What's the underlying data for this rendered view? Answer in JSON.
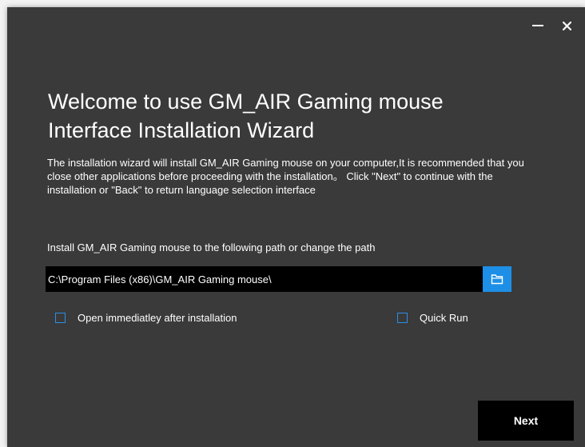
{
  "window": {
    "minimize_label": "—",
    "close_label": "✕"
  },
  "heading": {
    "line1": "Welcome to use GM_AIR Gaming mouse",
    "line2": "Interface Installation Wizard"
  },
  "description": "The installation wizard will install GM_AIR Gaming mouse on your computer,It is recommended that you close other applications before proceeding with the installation。 Click \"Next\" to continue with the installation or \"Back\" to return language selection interface",
  "install_path": {
    "label": "Install GM_AIR Gaming mouse to the following path or change the path",
    "value": "C:\\Program Files (x86)\\GM_AIR Gaming mouse\\",
    "browse_icon": "folder-icon"
  },
  "options": {
    "open_after_install": {
      "label": "Open immediatley after installation",
      "checked": false
    },
    "quick_run": {
      "label": "Quick Run",
      "checked": false
    }
  },
  "buttons": {
    "next_label": "Next"
  },
  "colors": {
    "window_bg": "#3a3a3a",
    "accent": "#1e8fe6",
    "input_bg": "#000000",
    "text": "#ffffff"
  }
}
